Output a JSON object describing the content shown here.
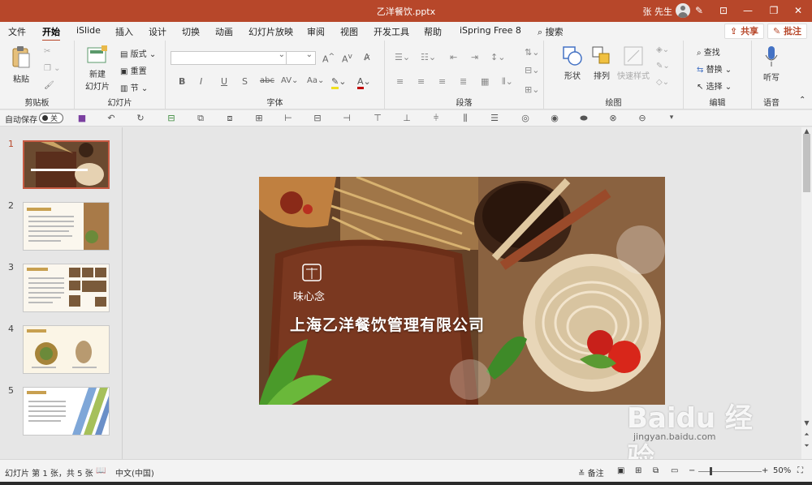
{
  "window": {
    "title": "乙洋餐饮.pptx",
    "user": "张 先生"
  },
  "tabs": [
    "文件",
    "开始",
    "iSlide",
    "插入",
    "设计",
    "切换",
    "动画",
    "幻灯片放映",
    "审阅",
    "视图",
    "开发工具",
    "帮助",
    "iSpring Free 8"
  ],
  "search": "搜索",
  "share": "共享",
  "comments": "批注",
  "ribbon": {
    "clipboard": {
      "paste": "粘贴",
      "label": "剪贴板"
    },
    "slides": {
      "new_slide": "新建\n幻灯片",
      "new_line1": "新建",
      "new_line2": "幻灯片",
      "layout": "版式",
      "reset": "重置",
      "section": "节",
      "label": "幻灯片"
    },
    "font": {
      "label": "字体",
      "bold": "B",
      "italic": "I",
      "underline": "U",
      "shadow": "S",
      "strike": "abc",
      "spacing": "AV",
      "case": "Aa",
      "grow": "A",
      "shrink": "A"
    },
    "paragraph": {
      "label": "段落"
    },
    "drawing": {
      "shapes": "形状",
      "arrange": "排列",
      "quick_styles": "快速样式",
      "label": "绘图"
    },
    "editing": {
      "find": "查找",
      "replace": "替换",
      "select": "选择",
      "label": "编辑"
    },
    "voice": {
      "dictate": "听写",
      "label": "语音"
    }
  },
  "qat": {
    "autosave": "自动保存",
    "toggle": "关"
  },
  "thumbnails": [
    {
      "num": "1",
      "title": "上海乙洋餐饮管理有限公司"
    },
    {
      "num": "2",
      "title": "公司简介"
    },
    {
      "num": "3",
      "title": "品牌简介"
    },
    {
      "num": "4",
      "title": "产品介绍"
    },
    {
      "num": "5",
      "title": "未来规划"
    }
  ],
  "slide": {
    "brand": "味心念",
    "company": "上海乙洋餐饮管理有限公司"
  },
  "status": {
    "slide_info": "幻灯片 第 1 张，共 5 张",
    "language": "中文(中国)",
    "notes": "备注",
    "zoom": "50%"
  },
  "watermark": {
    "logo": "Baidu 经验",
    "url": "jingyan.baidu.com"
  },
  "colors": {
    "accent": "#b7472a"
  }
}
